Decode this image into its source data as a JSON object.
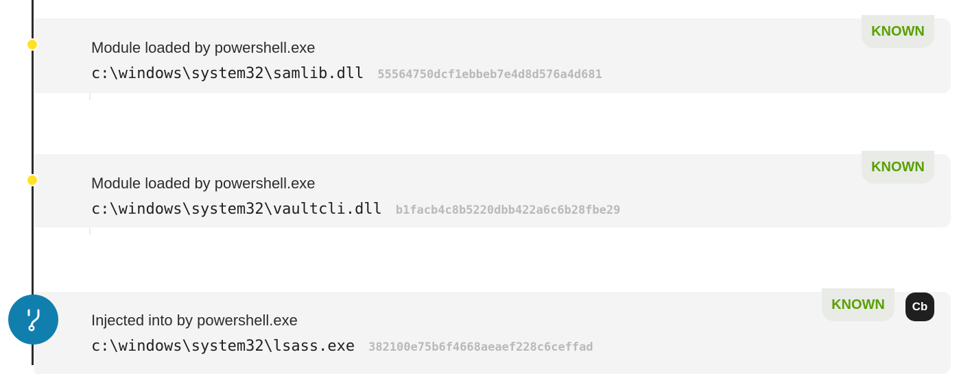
{
  "events": [
    {
      "description": "Module loaded by powershell.exe",
      "path": "c:\\windows\\system32\\samlib.dll",
      "hash": "55564750dcf1ebbeb7e4d8d576a4d681",
      "reputation": "KNOWN"
    },
    {
      "description": "Module loaded by powershell.exe",
      "path": "c:\\windows\\system32\\vaultcli.dll",
      "hash": "b1facb4c8b5220dbb422a6c6b28fbe29",
      "reputation": "KNOWN"
    },
    {
      "description": "Injected into by powershell.exe",
      "path": "c:\\windows\\system32\\lsass.exe",
      "hash": "382100e75b6f4668aeaef228c6ceffad",
      "reputation": "KNOWN",
      "source_badge": "Cb"
    }
  ],
  "icons": {
    "module_node": "circle-dot-icon",
    "inject_node": "branch-injection-icon"
  },
  "colors": {
    "timeline": "#2b2b2b",
    "module_dot": "#ffe227",
    "inject_node": "#117fae",
    "known_text": "#5aa000",
    "card_bg": "#f4f4f4",
    "hash_text": "#b9b9b9"
  }
}
